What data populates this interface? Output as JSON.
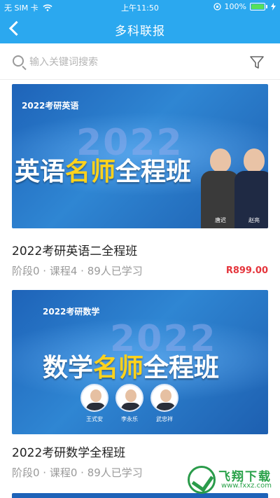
{
  "status_bar": {
    "carrier": "无 SIM 卡",
    "time": "上午11:50",
    "battery": "100%"
  },
  "nav": {
    "title": "多科联报"
  },
  "search": {
    "placeholder": "输入关键词搜索"
  },
  "courses": [
    {
      "banner_subtitle": "2022考研英语",
      "banner_year": "2022",
      "banner_headline_a": "英语",
      "banner_headline_hl": "名师",
      "banner_headline_b": "全程班",
      "teachers": [
        "唐迟",
        "赵亮"
      ],
      "title": "2022考研英语二全程班",
      "meta": "阶段0 · 课程4 · 89人已学习",
      "price": "R899.00"
    },
    {
      "banner_subtitle": "2022考研数学",
      "banner_year": "2022",
      "banner_headline_a": "数学",
      "banner_headline_hl": "名师",
      "banner_headline_b": "全程班",
      "teachers": [
        "王式安",
        "李永乐",
        "武忠祥"
      ],
      "title": "2022考研数学全程班",
      "meta": "阶段0 · 课程0 · 89人已学习",
      "price": ""
    }
  ],
  "watermark": {
    "text": "飞翔下载",
    "url": "www.fxxz.com"
  },
  "colors": {
    "header": "#2ba8ef",
    "price": "#e5363d",
    "highlight": "#ffd21c"
  }
}
